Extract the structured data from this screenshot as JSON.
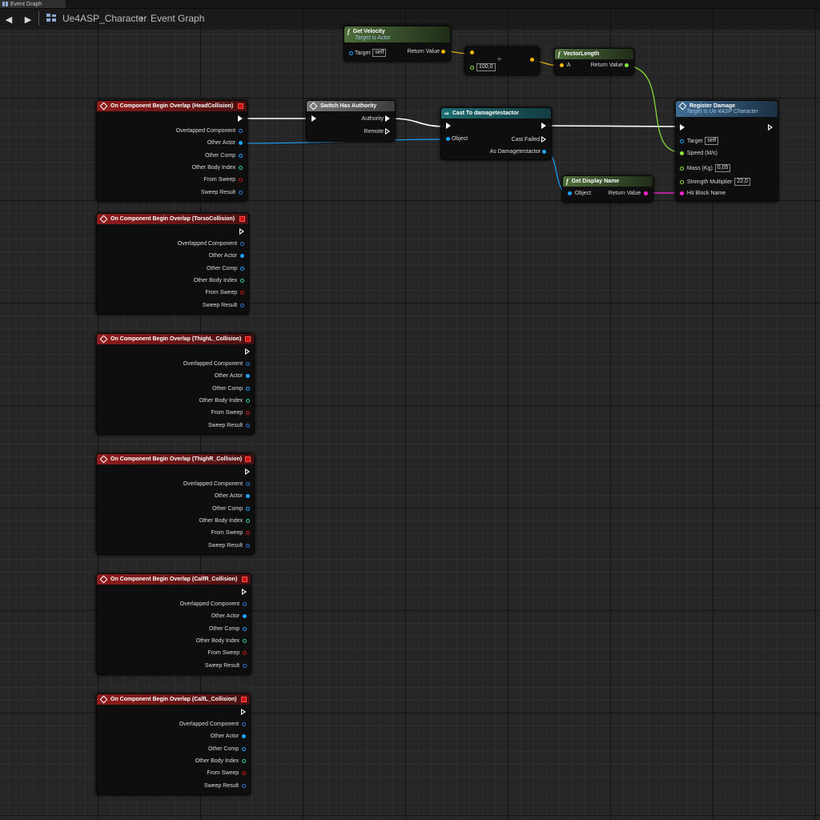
{
  "tab": {
    "label": "Event Graph"
  },
  "breadcrumb": {
    "blueprint": "Ue4ASP_Character",
    "separator": "›",
    "graph": "Event Graph"
  },
  "colors": {
    "exec": "#ffffff",
    "object": "#1aa3ff",
    "float": "#8ae53b",
    "vector": "#f4b70c",
    "name": "#ff25d6",
    "int": "#29d39a",
    "bool": "#c51717",
    "struct": "#2b7ad8",
    "event_header": "#8e1c1c"
  },
  "event_nodes": [
    {
      "title": "On Component Begin Overlap (HeadCollision)"
    },
    {
      "title": "On Component Begin Overlap (TorsoCollision)"
    },
    {
      "title": "On Component Begin Overlap (ThighL_Collision)"
    },
    {
      "title": "On Component Begin Overlap (ThighR_Collision)"
    },
    {
      "title": "On Component Begin Overlap (CalfR_Collision)"
    },
    {
      "title": "On Component Begin Overlap (CalfL_Collision)"
    }
  ],
  "event_pins": [
    "Overlapped Component",
    "Other Actor",
    "Other Comp",
    "Other Body Index",
    "From Sweep",
    "Sweep Result"
  ],
  "get_velocity": {
    "title": "Get Velocity",
    "subtitle": "Target is Actor",
    "target": "Target",
    "target_value": "self",
    "return": "Return Value"
  },
  "divide": {
    "symbol": "÷",
    "value": "100,0"
  },
  "vector_length": {
    "title": "VectorLength",
    "input": "A",
    "return": "Return Value"
  },
  "switch_authority": {
    "title": "Switch Has Authority",
    "authority": "Authority",
    "remote": "Remote"
  },
  "cast": {
    "title": "Cast To damagetestactor",
    "object": "Object",
    "failed": "Cast Failed",
    "as": "As Damagetestactor"
  },
  "display_name": {
    "title": "Get Display Name",
    "object": "Object",
    "return": "Return Value"
  },
  "register_damage": {
    "title": "Register Damage",
    "subtitle": "Target is Ue 4ASP Character",
    "target": "Target",
    "target_value": "self",
    "speed": "Speed (M/s)",
    "mass": "Mass (Kg)",
    "mass_value": "0,05",
    "strength": "Strength Multiplier",
    "strength_value": "22,0",
    "hit_block": "Hit Block Name"
  }
}
